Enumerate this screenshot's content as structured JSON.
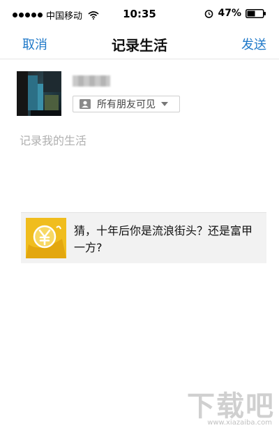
{
  "status_bar": {
    "carrier": "中国移动",
    "time": "10:35",
    "battery": "47%",
    "icons": [
      "signal-dots",
      "wifi-icon",
      "alarm-icon",
      "battery-icon"
    ]
  },
  "nav": {
    "cancel_label": "取消",
    "title": "记录生活",
    "send_label": "发送",
    "accent_color": "#1e78c8"
  },
  "post": {
    "visibility": "所有朋友可见",
    "compose_placeholder": "记录我的生活",
    "compose_value": ""
  },
  "share_card": {
    "text": "猜，十年后你是流浪街头？还是富甲一方?",
    "thumb_color": "#f0bd1e",
    "thumb_icon": "yen-coin-icon"
  },
  "watermark": {
    "text": "下载吧",
    "url": "www.xiazaiba.com"
  }
}
